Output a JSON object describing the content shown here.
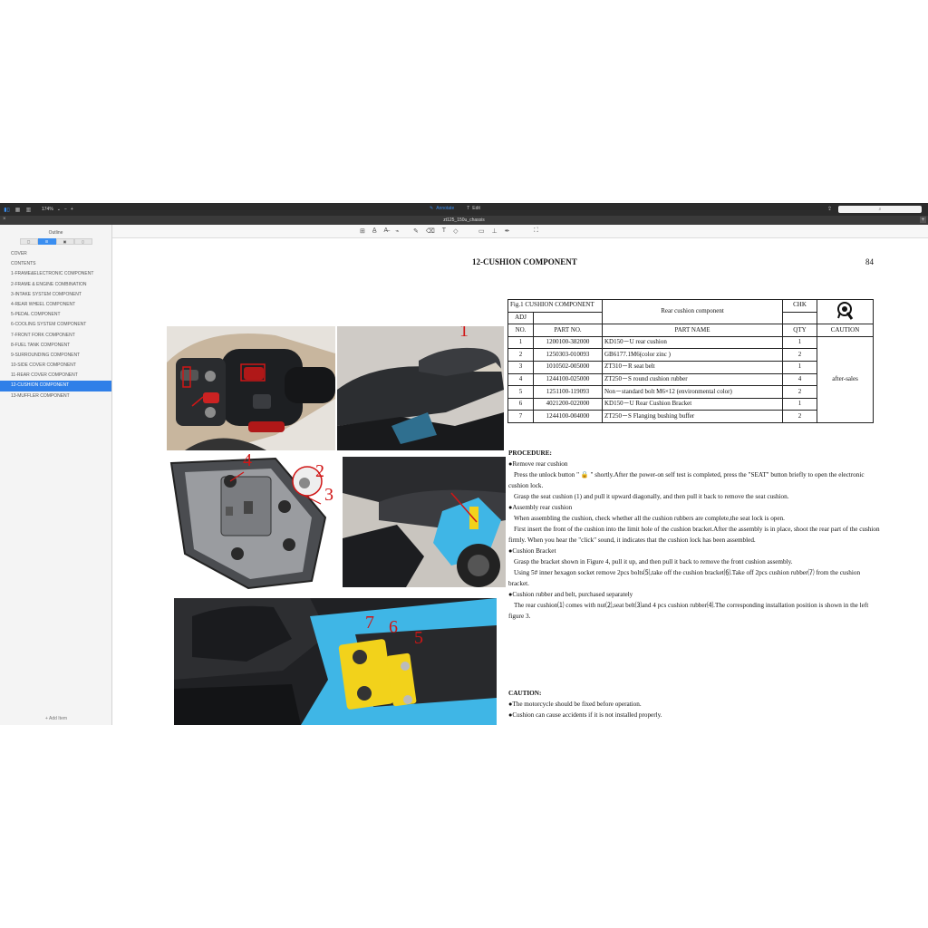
{
  "toolbar": {
    "zoom": "174%",
    "annotate_label": "Annotate",
    "edit_label": "Edit",
    "search_placeholder": "",
    "view_icons": [
      "sidebar-icon",
      "grid-icon",
      "two-page-icon"
    ]
  },
  "document": {
    "filename": "zt125_150u_chassis"
  },
  "sidebar": {
    "title": "Outline",
    "add_item": "+ Add Item",
    "items": [
      "COVER",
      "CONTENTS",
      "1-FRAME&ELECTRONIC COMPONENT",
      "2-FRAME & ENGINE COMBINATION",
      "3-INTAKE SYSTEM COMPONENT",
      "4-REAR WHEEL COMPONENT",
      "5-PEDAL COMPONENT",
      "6-COOLING SYSTEM COMPONENT",
      "7-FRONT FORK COMPONENT",
      "8-FUEL TANK COMPONENT",
      "9-SURROUNDING COMPONENT",
      "10-SIDE COVER COMPONENT",
      "11-REAR COVER COMPONENT",
      "12-CUSHION COMPONENT",
      "13-MUFFLER COMPONENT"
    ],
    "active_index": 13
  },
  "page": {
    "title": "12-CUSHION COMPONENT",
    "number": "84",
    "table": {
      "fig_label": "Fig.1 CUSHION COMPONENT",
      "component_name": "Rear cushion component",
      "chk": "CHK",
      "adj": "ADJ",
      "headers": [
        "NO.",
        "PART NO.",
        "PART NAME",
        "QTY",
        "CAUTION"
      ],
      "rows": [
        [
          "1",
          "1200100-382000",
          "KD150－U rear cushion",
          "1"
        ],
        [
          "2",
          "1250303-010093",
          "GB6177.1M6(color zinc )",
          "2"
        ],
        [
          "3",
          "1010502-005000",
          "ZT310－R seat belt",
          "1"
        ],
        [
          "4",
          "1244100-025000",
          "ZT250－S round cushion rubber",
          "4"
        ],
        [
          "5",
          "1251100-119093",
          "Non－standard bolt M6×12 (environmental color)",
          "2"
        ],
        [
          "6",
          "4021200-022000",
          "KD150－U Rear Cushion Bracket",
          "1"
        ],
        [
          "7",
          "1244100-004000",
          "ZT250－S Flanging bushing buffer",
          "2"
        ]
      ],
      "caution_note": "after-sales"
    },
    "procedure": {
      "heading": "PROCEDURE:",
      "lines": [
        "●Remove rear cushion",
        "Press the unlock button \" 🔒 \" shortly.After the power-on self test is completed, press the \"SEAT\" button briefly to open the electronic cushion lock.",
        "Grasp the seat cushion (1) and pull it upward diagonally, and then pull it back to remove the seat cushion.",
        "●Assembly rear cushion",
        "When assembling the cushion, check whether all the cushion rubbers are complete,the seat lock is open.",
        "First insert the front of the cushion into the limit hole of the cushion bracket.After the assembly is in place, shoot the rear part of the cushion firmly. When you hear the \"click\" sound, it indicates that the cushion lock has been assembled.",
        "●Cushion Bracket",
        "Grasp the bracket shown in Figure 4, pull it up, and then pull it back to remove the front cushion assembly.",
        "Using 5# inner hexagon socket remove 2pcs bolts⑸,take off the cushion bracket⑹.Take off 2pcs cushion rubber⑺ from the cushion bracket.",
        "●Cushion rubber and belt, purchased separately",
        "The rear cushion⑴ comes with nut⑵,seat belt⑶and 4 pcs cushion rubber⑷.The corresponding installation position is shown in the left figure 3."
      ]
    },
    "caution": {
      "heading": "CAUTION:",
      "lines": [
        "●The motorcycle should be fixed before operation.",
        "●Cushion can cause accidents if it is not installed properly."
      ]
    },
    "callouts": {
      "c1": "1",
      "c2": "2",
      "c3": "3",
      "c4": "4",
      "c5": "5",
      "c6": "6",
      "c7": "7"
    },
    "colors": {
      "callout": "#d01616",
      "bike_blue": "#3fb6e6",
      "bracket_yellow": "#f2d21b"
    }
  }
}
